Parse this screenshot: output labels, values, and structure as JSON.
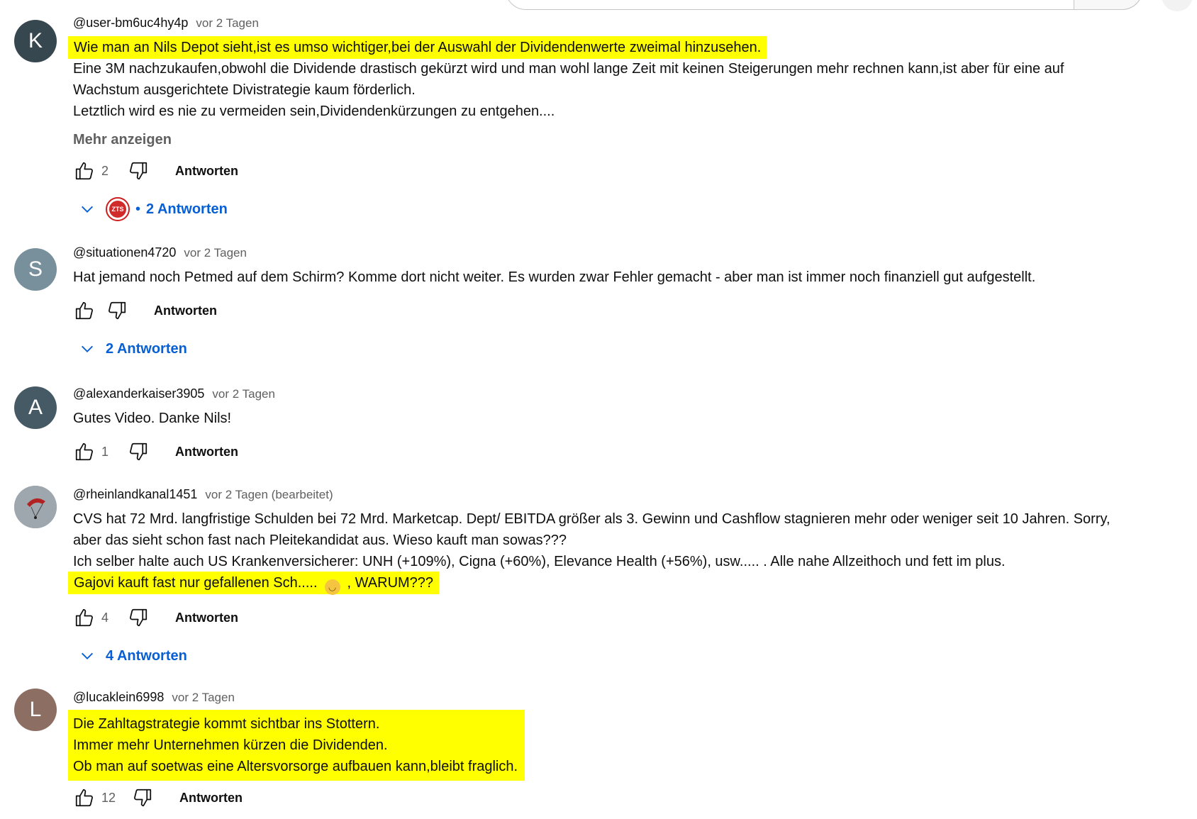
{
  "comments": [
    {
      "avatar_letter": "K",
      "avatar_color": "#37474f",
      "author": "@user-bm6uc4hy4p",
      "time": "vor 2 Tagen",
      "lines": [
        "Wie man an Nils Depot sieht,ist es umso wichtiger,bei der Auswahl der Dividendenwerte zweimal hinzusehen.",
        "Eine 3M nachzukaufen,obwohl die Dividende drastisch gekürzt wird und man wohl lange Zeit mit keinen Steigerungen mehr rechnen kann,ist aber für eine auf",
        "Wachstum ausgerichtete Divistrategie kaum förderlich.",
        "Letztlich wird es nie zu vermeiden sein,Dividendenkürzungen zu entgehen...."
      ],
      "more_label": "Mehr anzeigen",
      "likes": "2",
      "reply_label": "Antworten",
      "replies_label": "2 Antworten",
      "reply_avatar_text": "ZTS"
    },
    {
      "avatar_letter": "S",
      "avatar_color": "#78909c",
      "author": "@situationen4720",
      "time": "vor 2 Tagen",
      "lines": [
        "Hat jemand noch Petmed auf dem Schirm? Komme dort nicht weiter. Es wurden zwar Fehler gemacht - aber man ist immer noch finanziell gut aufgestellt."
      ],
      "likes": "",
      "reply_label": "Antworten",
      "replies_label": "2 Antworten"
    },
    {
      "avatar_letter": "A",
      "avatar_color": "#455a64",
      "author": "@alexanderkaiser3905",
      "time": "vor 2 Tagen",
      "lines": [
        "Gutes Video. Danke Nils!"
      ],
      "likes": "1",
      "reply_label": "Antworten"
    },
    {
      "avatar_color": "#9aa4ad",
      "author": "@rheinlandkanal1451",
      "time": "vor 2 Tagen (bearbeitet)",
      "lines": [
        "CVS hat 72 Mrd. langfristige Schulden bei 72 Mrd. Marketcap.    Dept/ EBITDA größer als 3. Gewinn und Cashflow stagnieren mehr oder weniger seit 10 Jahren. Sorry,",
        "aber das sieht schon fast nach Pleitekandidat aus. Wieso kauft man sowas???",
        "Ich selber halte auch US Krankenversicherer:  UNH (+109%), Cigna (+60%), Elevance Health (+56%), usw.....  .  Alle nahe Allzeithoch und fett im plus."
      ],
      "highlight_a": "Gajovi kauft fast nur gefallenen Sch.....",
      "highlight_b": ",     WARUM???",
      "likes": "4",
      "reply_label": "Antworten",
      "replies_label": "4 Antworten"
    },
    {
      "avatar_letter": "L",
      "avatar_color": "#8d6e63",
      "author": "@lucaklein6998",
      "time": "vor 2 Tagen",
      "lines": [
        "Die Zahltagstrategie kommt sichtbar ins Stottern.",
        "Immer mehr Unternehmen kürzen die Dividenden.",
        "Ob man auf soetwas eine Altersvorsorge aufbauen kann,bleibt fraglich."
      ],
      "likes": "12",
      "reply_label": "Antworten"
    }
  ],
  "colors": {
    "highlight": "#ffff00",
    "link": "#065fd4",
    "meta": "#606060"
  },
  "icons": [
    "thumb-up-icon",
    "thumb-down-icon",
    "chevron-down-icon",
    "emoji-icon"
  ]
}
